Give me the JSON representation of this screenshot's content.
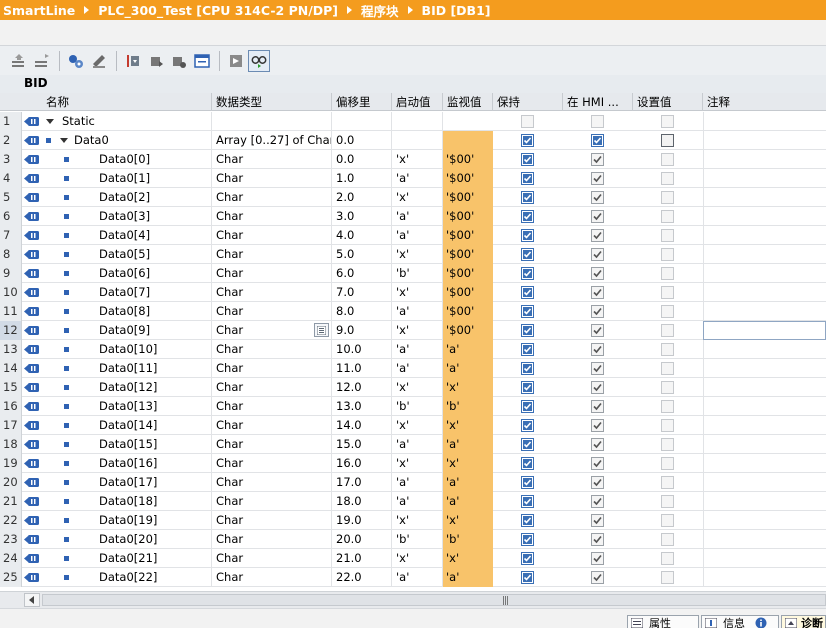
{
  "breadcrumb": [
    "SmartLine",
    "PLC_300_Test [CPU 314C-2 PN/DP]",
    "程序块",
    "BID [DB1]"
  ],
  "block_name": "BID",
  "columns": {
    "name": "名称",
    "datatype": "数据类型",
    "offset": "偏移里",
    "start_value": "启动值",
    "monitor_value": "监视值",
    "retain": "保持",
    "hmi": "在 HMI ...",
    "setpoint": "设置值",
    "comment": "注释"
  },
  "rows": [
    {
      "n": "1",
      "name": "Static",
      "type": "",
      "offset": "",
      "start": "",
      "monitor": "",
      "retain": false,
      "hmi": false,
      "setpoint": false,
      "level": 0,
      "kind": "section"
    },
    {
      "n": "2",
      "name": "Data0",
      "type": "Array [0..27] of Char",
      "offset": "0.0",
      "start": "",
      "monitor": "",
      "retain": true,
      "hmi": true,
      "setpoint": false,
      "level": 1,
      "kind": "array"
    },
    {
      "n": "3",
      "name": "Data0[0]",
      "type": "Char",
      "offset": "0.0",
      "start": "'x'",
      "monitor": "'$00'",
      "retain": true,
      "hmi": true,
      "setpoint": false,
      "level": 2
    },
    {
      "n": "4",
      "name": "Data0[1]",
      "type": "Char",
      "offset": "1.0",
      "start": "'a'",
      "monitor": "'$00'",
      "retain": true,
      "hmi": true,
      "setpoint": false,
      "level": 2
    },
    {
      "n": "5",
      "name": "Data0[2]",
      "type": "Char",
      "offset": "2.0",
      "start": "'x'",
      "monitor": "'$00'",
      "retain": true,
      "hmi": true,
      "setpoint": false,
      "level": 2
    },
    {
      "n": "6",
      "name": "Data0[3]",
      "type": "Char",
      "offset": "3.0",
      "start": "'a'",
      "monitor": "'$00'",
      "retain": true,
      "hmi": true,
      "setpoint": false,
      "level": 2
    },
    {
      "n": "7",
      "name": "Data0[4]",
      "type": "Char",
      "offset": "4.0",
      "start": "'a'",
      "monitor": "'$00'",
      "retain": true,
      "hmi": true,
      "setpoint": false,
      "level": 2
    },
    {
      "n": "8",
      "name": "Data0[5]",
      "type": "Char",
      "offset": "5.0",
      "start": "'x'",
      "monitor": "'$00'",
      "retain": true,
      "hmi": true,
      "setpoint": false,
      "level": 2
    },
    {
      "n": "9",
      "name": "Data0[6]",
      "type": "Char",
      "offset": "6.0",
      "start": "'b'",
      "monitor": "'$00'",
      "retain": true,
      "hmi": true,
      "setpoint": false,
      "level": 2
    },
    {
      "n": "10",
      "name": "Data0[7]",
      "type": "Char",
      "offset": "7.0",
      "start": "'x'",
      "monitor": "'$00'",
      "retain": true,
      "hmi": true,
      "setpoint": false,
      "level": 2
    },
    {
      "n": "11",
      "name": "Data0[8]",
      "type": "Char",
      "offset": "8.0",
      "start": "'a'",
      "monitor": "'$00'",
      "retain": true,
      "hmi": true,
      "setpoint": false,
      "level": 2
    },
    {
      "n": "12",
      "name": "Data0[9]",
      "type": "Char",
      "offset": "9.0",
      "start": "'x'",
      "monitor": "'$00'",
      "retain": true,
      "hmi": true,
      "setpoint": false,
      "level": 2,
      "selected": true
    },
    {
      "n": "13",
      "name": "Data0[10]",
      "type": "Char",
      "offset": "10.0",
      "start": "'a'",
      "monitor": "'a'",
      "retain": true,
      "hmi": true,
      "setpoint": false,
      "level": 2
    },
    {
      "n": "14",
      "name": "Data0[11]",
      "type": "Char",
      "offset": "11.0",
      "start": "'a'",
      "monitor": "'a'",
      "retain": true,
      "hmi": true,
      "setpoint": false,
      "level": 2
    },
    {
      "n": "15",
      "name": "Data0[12]",
      "type": "Char",
      "offset": "12.0",
      "start": "'x'",
      "monitor": "'x'",
      "retain": true,
      "hmi": true,
      "setpoint": false,
      "level": 2
    },
    {
      "n": "16",
      "name": "Data0[13]",
      "type": "Char",
      "offset": "13.0",
      "start": "'b'",
      "monitor": "'b'",
      "retain": true,
      "hmi": true,
      "setpoint": false,
      "level": 2
    },
    {
      "n": "17",
      "name": "Data0[14]",
      "type": "Char",
      "offset": "14.0",
      "start": "'x'",
      "monitor": "'x'",
      "retain": true,
      "hmi": true,
      "setpoint": false,
      "level": 2
    },
    {
      "n": "18",
      "name": "Data0[15]",
      "type": "Char",
      "offset": "15.0",
      "start": "'a'",
      "monitor": "'a'",
      "retain": true,
      "hmi": true,
      "setpoint": false,
      "level": 2
    },
    {
      "n": "19",
      "name": "Data0[16]",
      "type": "Char",
      "offset": "16.0",
      "start": "'x'",
      "monitor": "'x'",
      "retain": true,
      "hmi": true,
      "setpoint": false,
      "level": 2
    },
    {
      "n": "20",
      "name": "Data0[17]",
      "type": "Char",
      "offset": "17.0",
      "start": "'a'",
      "monitor": "'a'",
      "retain": true,
      "hmi": true,
      "setpoint": false,
      "level": 2
    },
    {
      "n": "21",
      "name": "Data0[18]",
      "type": "Char",
      "offset": "18.0",
      "start": "'a'",
      "monitor": "'a'",
      "retain": true,
      "hmi": true,
      "setpoint": false,
      "level": 2
    },
    {
      "n": "22",
      "name": "Data0[19]",
      "type": "Char",
      "offset": "19.0",
      "start": "'x'",
      "monitor": "'x'",
      "retain": true,
      "hmi": true,
      "setpoint": false,
      "level": 2
    },
    {
      "n": "23",
      "name": "Data0[20]",
      "type": "Char",
      "offset": "20.0",
      "start": "'b'",
      "monitor": "'b'",
      "retain": true,
      "hmi": true,
      "setpoint": false,
      "level": 2
    },
    {
      "n": "24",
      "name": "Data0[21]",
      "type": "Char",
      "offset": "21.0",
      "start": "'x'",
      "monitor": "'x'",
      "retain": true,
      "hmi": true,
      "setpoint": false,
      "level": 2
    },
    {
      "n": "25",
      "name": "Data0[22]",
      "type": "Char",
      "offset": "22.0",
      "start": "'a'",
      "monitor": "'a'",
      "retain": true,
      "hmi": true,
      "setpoint": false,
      "level": 2
    }
  ],
  "status_tabs": [
    "属性",
    "信息",
    "诊断"
  ],
  "colors": {
    "title_bar": "#f49c1e",
    "monitor_highlight": "#f8c36a",
    "checkbox_blue": "#3a6fb5"
  }
}
